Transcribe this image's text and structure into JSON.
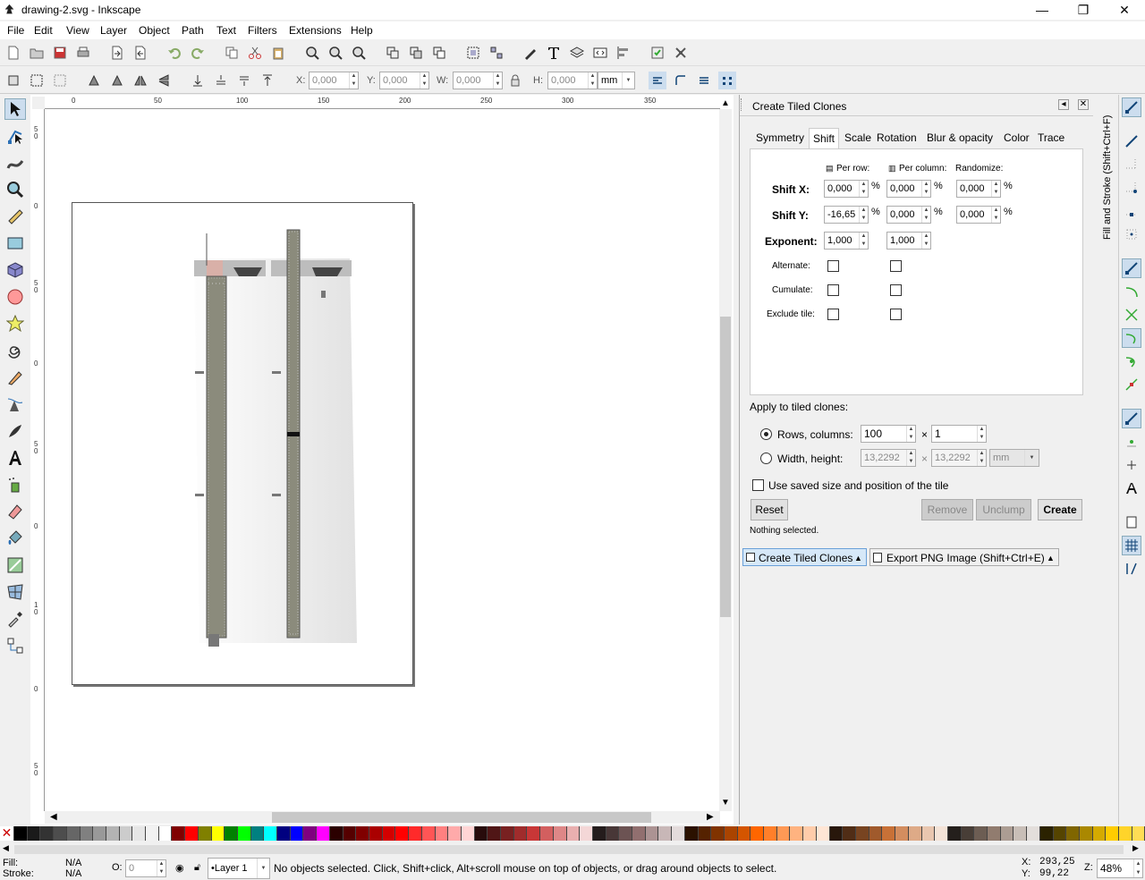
{
  "window": {
    "title": "drawing-2.svg - Inkscape",
    "minimize": "—",
    "maximize": "❐",
    "close": "✕"
  },
  "menu": [
    "File",
    "Edit",
    "View",
    "Layer",
    "Object",
    "Path",
    "Text",
    "Filters",
    "Extensions",
    "Help"
  ],
  "toolbar": {
    "x_label": "X:",
    "x_value": "0,000",
    "y_label": "Y:",
    "y_value": "0,000",
    "w_label": "W:",
    "w_value": "0,000",
    "h_label": "H:",
    "h_value": "0,000",
    "unit": "mm"
  },
  "ruler": {
    "h": [
      "0",
      "50",
      "100",
      "150",
      "200",
      "250",
      "300",
      "350"
    ],
    "v": [
      "5",
      "0",
      "0",
      "5",
      "0",
      "0",
      "5",
      "0",
      "0",
      "1",
      "0",
      "0",
      "5",
      "0"
    ]
  },
  "dialog": {
    "title": "Create Tiled Clones",
    "tabs": [
      "Symmetry",
      "Shift",
      "Scale",
      "Rotation",
      "Blur & opacity",
      "Color",
      "Trace"
    ],
    "active_tab": "Shift",
    "per_row": "Per row:",
    "per_column": "Per column:",
    "randomize": "Randomize:",
    "shift_x_label": "Shift X:",
    "shift_y_label": "Shift Y:",
    "exponent_label": "Exponent:",
    "shift_x": [
      "0,000",
      "0,000",
      "0,000"
    ],
    "shift_y": [
      "-16,65",
      "0,000",
      "0,000"
    ],
    "exponent": [
      "1,000",
      "1,000"
    ],
    "percent": "%",
    "alternate": "Alternate:",
    "cumulate": "Cumulate:",
    "exclude": "Exclude tile:",
    "apply_label": "Apply to tiled clones:",
    "rows_cols_label": "Rows, columns:",
    "rows": "100",
    "cols": "1",
    "times": "×",
    "width_height_label": "Width, height:",
    "width": "13,2292",
    "height": "13,2292",
    "wh_unit": "mm",
    "use_saved": "Use saved size and position of the tile",
    "reset": "Reset",
    "remove": "Remove",
    "unclump": "Unclump",
    "create": "Create",
    "status": "Nothing selected."
  },
  "dock_tabs": [
    "Create Tiled Clones",
    "Export PNG Image (Shift+Ctrl+E)"
  ],
  "side_tab": "Fill and Stroke (Shift+Ctrl+F)",
  "palette": [
    "#000000",
    "#1a1a1a",
    "#333333",
    "#4d4d4d",
    "#666666",
    "#808080",
    "#999999",
    "#b3b3b3",
    "#cccccc",
    "#e6e6e6",
    "#f2f2f2",
    "#ffffff",
    "#800000",
    "#ff0000",
    "#808000",
    "#ffff00",
    "#008000",
    "#00ff00",
    "#008080",
    "#00ffff",
    "#000080",
    "#0000ff",
    "#800080",
    "#ff00ff",
    "#2b0000",
    "#550000",
    "#800000",
    "#aa0000",
    "#d40000",
    "#ff0000",
    "#ff2a2a",
    "#ff5555",
    "#ff8080",
    "#ffaaaa",
    "#ffd5d5",
    "#280b0b",
    "#501616",
    "#782121",
    "#a02c2c",
    "#c83737",
    "#d35f5f",
    "#de8787",
    "#e9afaf",
    "#f4d7d7",
    "#241c1c",
    "#483737",
    "#6c5353",
    "#916f6f",
    "#ac9393",
    "#c8b7b7",
    "#e3dbdb",
    "#2b1100",
    "#552200",
    "#803300",
    "#aa4400",
    "#d45500",
    "#ff6600",
    "#ff7f2a",
    "#ff9955",
    "#ffb380",
    "#ffccaa",
    "#ffe6d5",
    "#28170b",
    "#502d16",
    "#784421",
    "#a05a2c",
    "#c87137",
    "#d38d5f",
    "#deaa87",
    "#e9c6af",
    "#f4e3d7",
    "#241f1c",
    "#483e37",
    "#6c5d53",
    "#917c6f",
    "#ac9d93",
    "#c8beb7",
    "#e3dedb",
    "#2b2200",
    "#554400",
    "#806600",
    "#aa8800",
    "#d4aa00",
    "#ffcc00",
    "#ffd42a",
    "#ffdd55"
  ],
  "status": {
    "fill_label": "Fill:",
    "fill_value": "N/A",
    "stroke_label": "Stroke:",
    "stroke_value": "N/A",
    "opacity_label": "O:",
    "opacity_value": "0",
    "layer": "•Layer 1",
    "message": "No objects selected. Click, Shift+click, Alt+scroll mouse on top of objects, or drag around objects to select.",
    "x_label": "X:",
    "x_value": "293,25",
    "y_label": "Y:",
    "y_value": "99,22",
    "zoom_label": "Z:",
    "zoom_value": "48%"
  }
}
